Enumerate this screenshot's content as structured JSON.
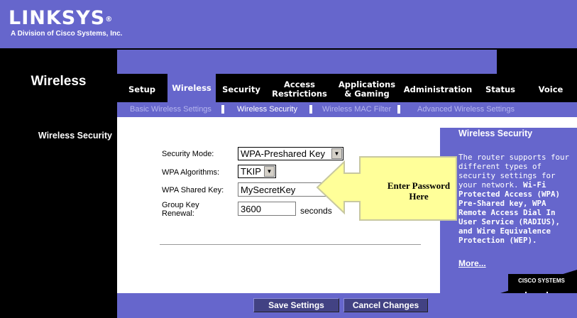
{
  "brand": {
    "logo_text": "LINKSYS",
    "logo_mark": "®",
    "subtitle": "A Division of Cisco Systems, Inc."
  },
  "page_title": "Wireless",
  "tabs": [
    {
      "label": "Setup",
      "active": false
    },
    {
      "label": "Wireless",
      "active": true
    },
    {
      "label": "Security",
      "active": false
    },
    {
      "label": "Access Restrictions",
      "active": false
    },
    {
      "label": "Applications & Gaming",
      "active": false
    },
    {
      "label": "Administration",
      "active": false
    },
    {
      "label": "Status",
      "active": false
    },
    {
      "label": "Voice",
      "active": false
    }
  ],
  "subtabs": [
    {
      "label": "Basic Wireless Settings",
      "active": false
    },
    {
      "label": "Wireless Security",
      "active": true
    },
    {
      "label": "Wireless MAC Filter",
      "active": false
    },
    {
      "label": "Advanced Wireless Settings",
      "active": false
    }
  ],
  "section_label": "Wireless Security",
  "form": {
    "security_mode": {
      "label": "Security Mode:",
      "value": "WPA-Preshared Key"
    },
    "wpa_algorithms": {
      "label": "WPA Algorithms:",
      "value": "TKIP"
    },
    "shared_key": {
      "label": "WPA Shared  Key:",
      "value": "MySecretKey"
    },
    "group_key": {
      "label_line1": "Group Key",
      "label_line2": "Renewal:",
      "value": "3600",
      "unit": "seconds"
    }
  },
  "help": {
    "title": "Wireless Security",
    "body_plain": "The router supports four different types of security settings for your network.",
    "body_bold": "Wi-Fi Protected Access (WPA) Pre-Shared key, WPA Remote Access Dial In User Service (RADIUS), and Wire Equivalence Protection (WEP).",
    "more_link": "More..."
  },
  "cisco": {
    "text": "CISCO SYSTEMS"
  },
  "buttons": {
    "save": "Save Settings",
    "cancel": "Cancel Changes"
  },
  "callout": {
    "line1": "Enter Password",
    "line2": "Here"
  },
  "colors": {
    "brand_blue": "#6666cc",
    "band": "#000000",
    "button": "#424283",
    "callout": "#ffff99"
  }
}
